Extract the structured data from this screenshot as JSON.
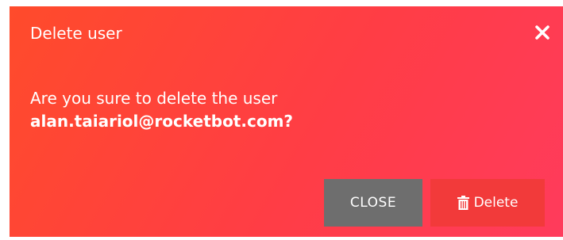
{
  "dialog": {
    "title": "Delete user",
    "message": "Are you sure to delete the user",
    "email": "alan.taiariol@rocketbot.com?",
    "close_label": "CLOSE",
    "delete_label": "Delete",
    "icons": {
      "close": "close-icon",
      "delete": "trash-icon"
    },
    "colors": {
      "gradient_start": "#ff4b2b",
      "gradient_end": "#ff3b5c",
      "close_button": "#6e6e6e",
      "delete_button": "#f23a3a"
    }
  }
}
